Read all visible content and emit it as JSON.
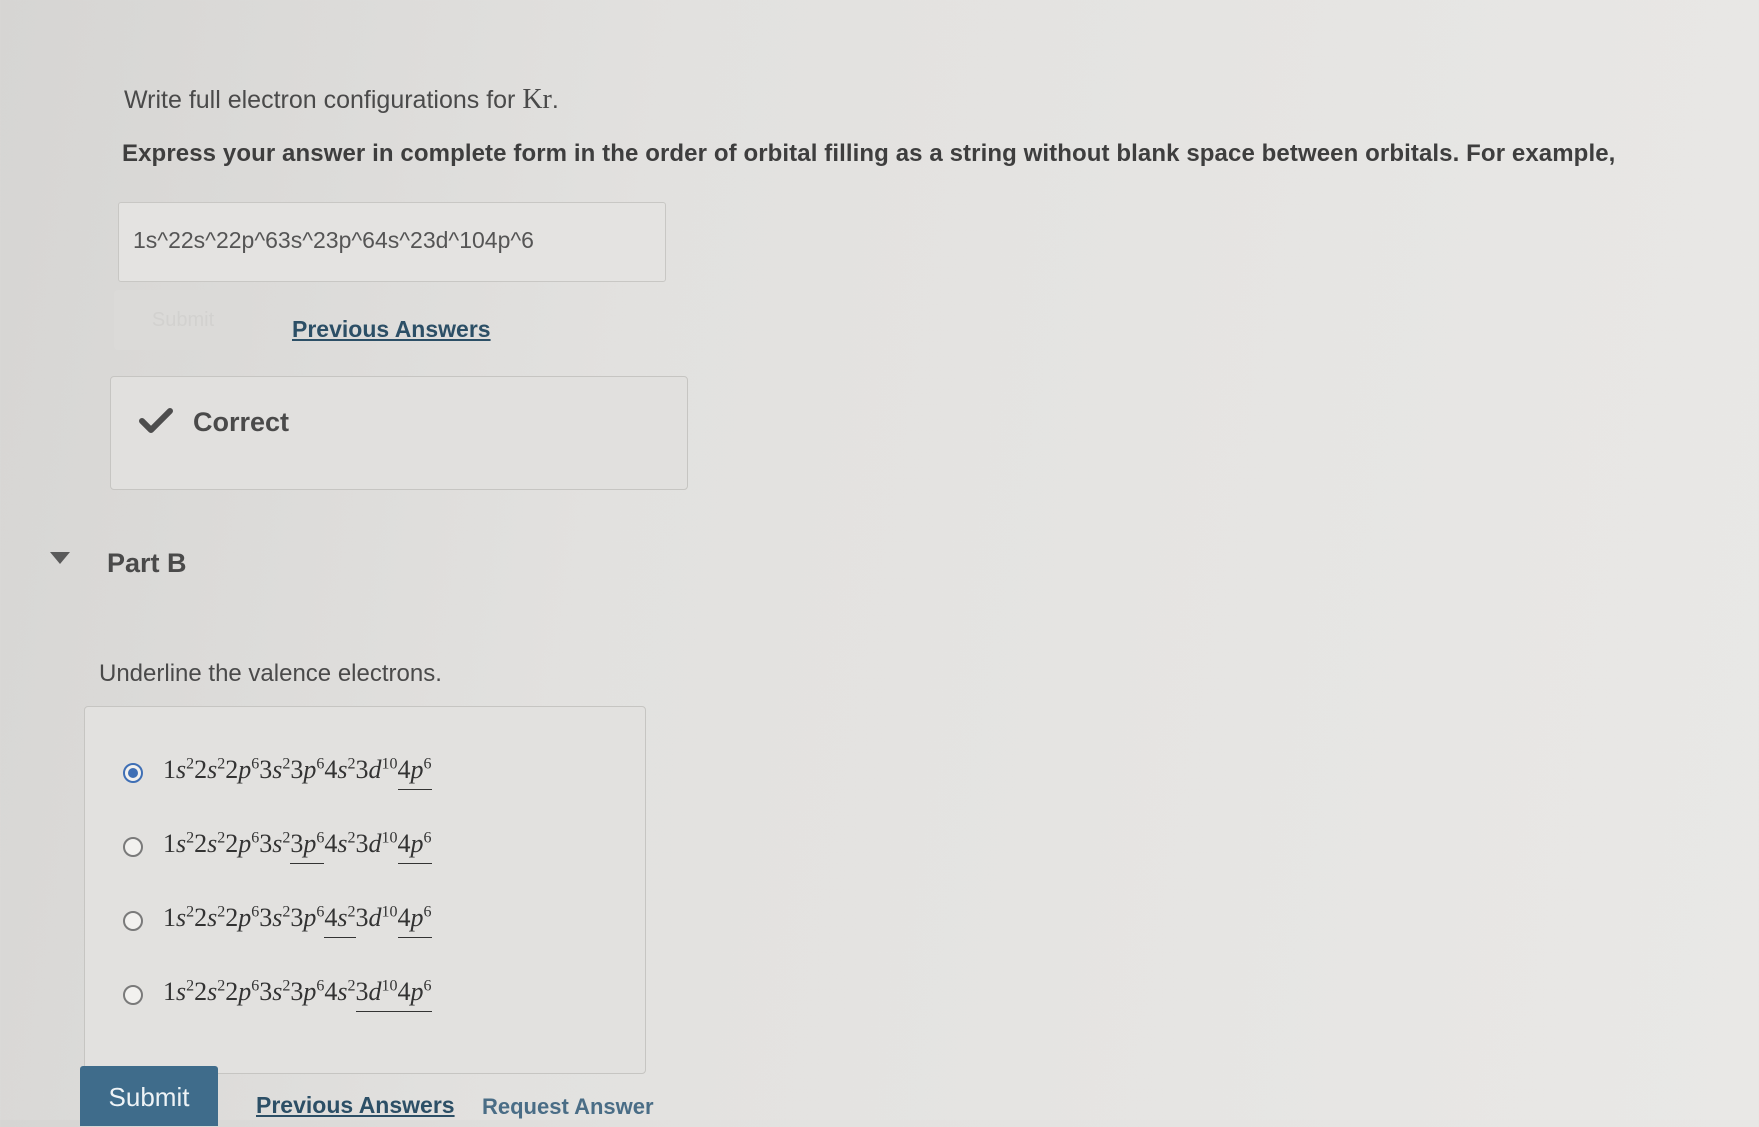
{
  "partA": {
    "prompt_text": "Write full electron configurations for ",
    "prompt_element": "Kr",
    "instructions": "Express your answer in complete form in the order of orbital filling as a string without blank space between orbitals. For example,",
    "answer_value": "1s^22s^22p^63s^23p^64s^23d^104p^6",
    "submit_label": "Submit",
    "previous_answers_label": "Previous Answers",
    "feedback_label": "Correct"
  },
  "partB": {
    "title": "Part B",
    "question": "Underline the valence electrons.",
    "submit_label": "Submit",
    "previous_answers_label": "Previous Answers",
    "request_answer_label": "Request Answer",
    "selected_index": 0,
    "options": [
      {
        "underlined_terms": [
          "4p6"
        ]
      },
      {
        "underlined_terms": [
          "3p6",
          "4p6"
        ]
      },
      {
        "underlined_terms": [
          "4s2",
          "4p6"
        ]
      },
      {
        "underlined_terms": [
          "3d10",
          "4p6"
        ]
      }
    ],
    "terms": [
      {
        "n": "1",
        "l": "s",
        "e": "2"
      },
      {
        "n": "2",
        "l": "s",
        "e": "2"
      },
      {
        "n": "2",
        "l": "p",
        "e": "6"
      },
      {
        "n": "3",
        "l": "s",
        "e": "2"
      },
      {
        "n": "3",
        "l": "p",
        "e": "6"
      },
      {
        "n": "4",
        "l": "s",
        "e": "2"
      },
      {
        "n": "3",
        "l": "d",
        "e": "10"
      },
      {
        "n": "4",
        "l": "p",
        "e": "6"
      }
    ]
  },
  "colors": {
    "link": "#2c4f66",
    "submit_bg": "#3f6c8b",
    "radio_selected": "#3f6fb5",
    "check": "#4d4d4d"
  }
}
